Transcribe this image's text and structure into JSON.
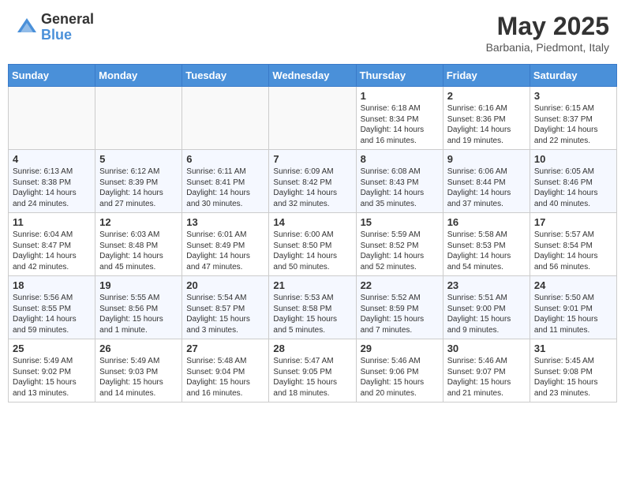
{
  "header": {
    "logo_general": "General",
    "logo_blue": "Blue",
    "month_title": "May 2025",
    "subtitle": "Barbania, Piedmont, Italy"
  },
  "days_of_week": [
    "Sunday",
    "Monday",
    "Tuesday",
    "Wednesday",
    "Thursday",
    "Friday",
    "Saturday"
  ],
  "weeks": [
    [
      {
        "day": "",
        "info": ""
      },
      {
        "day": "",
        "info": ""
      },
      {
        "day": "",
        "info": ""
      },
      {
        "day": "",
        "info": ""
      },
      {
        "day": "1",
        "info": "Sunrise: 6:18 AM\nSunset: 8:34 PM\nDaylight: 14 hours\nand 16 minutes."
      },
      {
        "day": "2",
        "info": "Sunrise: 6:16 AM\nSunset: 8:36 PM\nDaylight: 14 hours\nand 19 minutes."
      },
      {
        "day": "3",
        "info": "Sunrise: 6:15 AM\nSunset: 8:37 PM\nDaylight: 14 hours\nand 22 minutes."
      }
    ],
    [
      {
        "day": "4",
        "info": "Sunrise: 6:13 AM\nSunset: 8:38 PM\nDaylight: 14 hours\nand 24 minutes."
      },
      {
        "day": "5",
        "info": "Sunrise: 6:12 AM\nSunset: 8:39 PM\nDaylight: 14 hours\nand 27 minutes."
      },
      {
        "day": "6",
        "info": "Sunrise: 6:11 AM\nSunset: 8:41 PM\nDaylight: 14 hours\nand 30 minutes."
      },
      {
        "day": "7",
        "info": "Sunrise: 6:09 AM\nSunset: 8:42 PM\nDaylight: 14 hours\nand 32 minutes."
      },
      {
        "day": "8",
        "info": "Sunrise: 6:08 AM\nSunset: 8:43 PM\nDaylight: 14 hours\nand 35 minutes."
      },
      {
        "day": "9",
        "info": "Sunrise: 6:06 AM\nSunset: 8:44 PM\nDaylight: 14 hours\nand 37 minutes."
      },
      {
        "day": "10",
        "info": "Sunrise: 6:05 AM\nSunset: 8:46 PM\nDaylight: 14 hours\nand 40 minutes."
      }
    ],
    [
      {
        "day": "11",
        "info": "Sunrise: 6:04 AM\nSunset: 8:47 PM\nDaylight: 14 hours\nand 42 minutes."
      },
      {
        "day": "12",
        "info": "Sunrise: 6:03 AM\nSunset: 8:48 PM\nDaylight: 14 hours\nand 45 minutes."
      },
      {
        "day": "13",
        "info": "Sunrise: 6:01 AM\nSunset: 8:49 PM\nDaylight: 14 hours\nand 47 minutes."
      },
      {
        "day": "14",
        "info": "Sunrise: 6:00 AM\nSunset: 8:50 PM\nDaylight: 14 hours\nand 50 minutes."
      },
      {
        "day": "15",
        "info": "Sunrise: 5:59 AM\nSunset: 8:52 PM\nDaylight: 14 hours\nand 52 minutes."
      },
      {
        "day": "16",
        "info": "Sunrise: 5:58 AM\nSunset: 8:53 PM\nDaylight: 14 hours\nand 54 minutes."
      },
      {
        "day": "17",
        "info": "Sunrise: 5:57 AM\nSunset: 8:54 PM\nDaylight: 14 hours\nand 56 minutes."
      }
    ],
    [
      {
        "day": "18",
        "info": "Sunrise: 5:56 AM\nSunset: 8:55 PM\nDaylight: 14 hours\nand 59 minutes."
      },
      {
        "day": "19",
        "info": "Sunrise: 5:55 AM\nSunset: 8:56 PM\nDaylight: 15 hours\nand 1 minute."
      },
      {
        "day": "20",
        "info": "Sunrise: 5:54 AM\nSunset: 8:57 PM\nDaylight: 15 hours\nand 3 minutes."
      },
      {
        "day": "21",
        "info": "Sunrise: 5:53 AM\nSunset: 8:58 PM\nDaylight: 15 hours\nand 5 minutes."
      },
      {
        "day": "22",
        "info": "Sunrise: 5:52 AM\nSunset: 8:59 PM\nDaylight: 15 hours\nand 7 minutes."
      },
      {
        "day": "23",
        "info": "Sunrise: 5:51 AM\nSunset: 9:00 PM\nDaylight: 15 hours\nand 9 minutes."
      },
      {
        "day": "24",
        "info": "Sunrise: 5:50 AM\nSunset: 9:01 PM\nDaylight: 15 hours\nand 11 minutes."
      }
    ],
    [
      {
        "day": "25",
        "info": "Sunrise: 5:49 AM\nSunset: 9:02 PM\nDaylight: 15 hours\nand 13 minutes."
      },
      {
        "day": "26",
        "info": "Sunrise: 5:49 AM\nSunset: 9:03 PM\nDaylight: 15 hours\nand 14 minutes."
      },
      {
        "day": "27",
        "info": "Sunrise: 5:48 AM\nSunset: 9:04 PM\nDaylight: 15 hours\nand 16 minutes."
      },
      {
        "day": "28",
        "info": "Sunrise: 5:47 AM\nSunset: 9:05 PM\nDaylight: 15 hours\nand 18 minutes."
      },
      {
        "day": "29",
        "info": "Sunrise: 5:46 AM\nSunset: 9:06 PM\nDaylight: 15 hours\nand 20 minutes."
      },
      {
        "day": "30",
        "info": "Sunrise: 5:46 AM\nSunset: 9:07 PM\nDaylight: 15 hours\nand 21 minutes."
      },
      {
        "day": "31",
        "info": "Sunrise: 5:45 AM\nSunset: 9:08 PM\nDaylight: 15 hours\nand 23 minutes."
      }
    ]
  ]
}
